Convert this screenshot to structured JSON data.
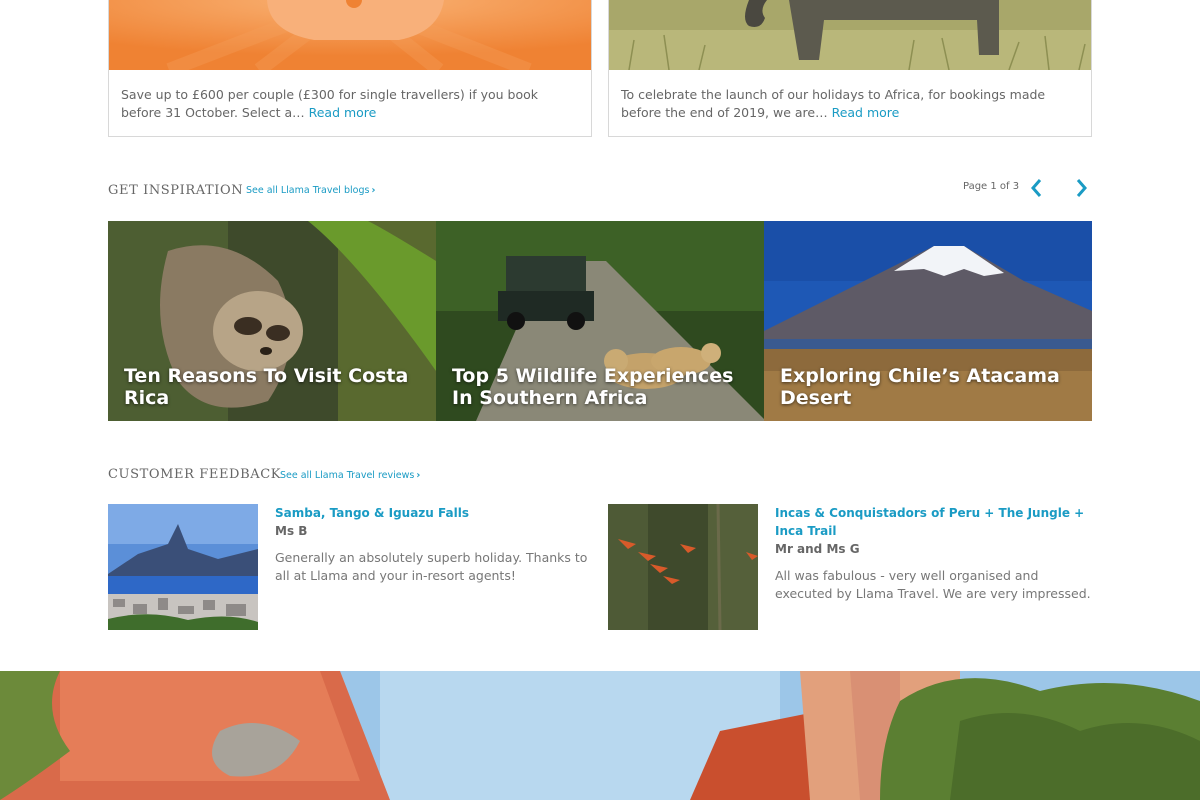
{
  "offers": [
    {
      "text": "Save up to £600 per couple (£300 for single travellers) if you book before 31 October. Select a…",
      "read_more": "Read more"
    },
    {
      "text": "To celebrate the launch of our holidays to Africa, for bookings made before the end of 2019, we are…",
      "read_more": "Read more"
    }
  ],
  "inspiration": {
    "title": "GET INSPIRATION",
    "see_all": "See all Llama Travel blogs",
    "pager_text": "Page 1 of 3",
    "blogs": [
      {
        "title": "Ten Reasons To Visit Costa Rica"
      },
      {
        "title": "Top 5 Wildlife Experiences In Southern Africa"
      },
      {
        "title": "Exploring Chile’s Atacama Desert"
      }
    ]
  },
  "feedback": {
    "title": "CUSTOMER FEEDBACK",
    "see_all": "See all Llama Travel reviews",
    "reviews": [
      {
        "trip": "Samba, Tango & Iguazu Falls",
        "author": "Ms B",
        "text": "Generally an absolutely superb holiday. Thanks to all at Llama and your in-resort agents!"
      },
      {
        "trip": "Incas & Conquistadors of Peru + The Jungle + Inca Trail",
        "author": "Mr and Ms G",
        "text": "All was fabulous - very well organised and executed by Llama Travel. We are very impressed."
      }
    ]
  },
  "colors": {
    "accent": "#1a9bc4",
    "offer_orange": "#f08a3a"
  }
}
